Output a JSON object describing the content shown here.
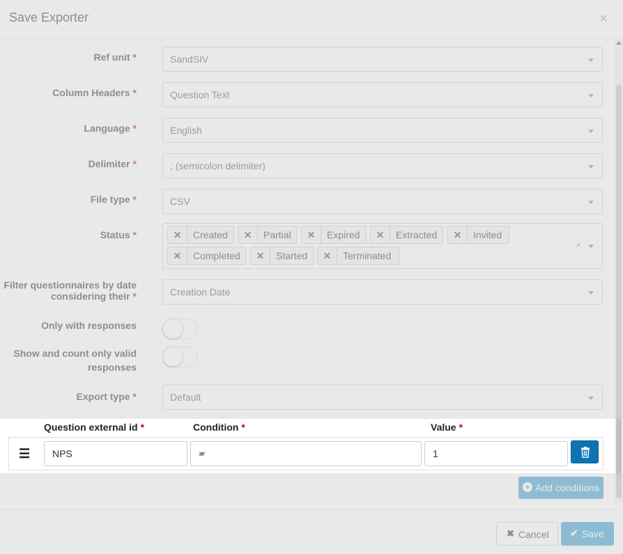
{
  "modal": {
    "title": "Save Exporter",
    "close_glyph": "×"
  },
  "form": {
    "ref_unit": {
      "label": "Ref unit",
      "value": "SandSIV"
    },
    "column_headers": {
      "label": "Column Headers",
      "value": "Question Text"
    },
    "language": {
      "label": "Language",
      "value": "English"
    },
    "delimiter": {
      "label": "Delimiter",
      "value": "; (semicolon delimiter)"
    },
    "file_type": {
      "label": "File type",
      "value": "CSV"
    },
    "status": {
      "label": "Status",
      "tags": [
        "Created",
        "Partial",
        "Expired",
        "Extracted",
        "Invited",
        "Completed",
        "Started",
        "Terminated"
      ],
      "clear_glyph": "×"
    },
    "filter_date": {
      "label_line1": "Filter questionnaires by date",
      "label_line2": "considering their",
      "value": "Creation Date"
    },
    "only_responses": {
      "label": "Only with responses"
    },
    "valid_responses": {
      "label_line1": "Show and count only valid",
      "label_line2": "responses"
    },
    "export_type": {
      "label": "Export type",
      "value": "Default"
    },
    "required_mark": "*"
  },
  "conditions": {
    "headers": {
      "question_id": "Question external id",
      "condition": "Condition",
      "value": "Value"
    },
    "row": {
      "drag_glyph": "☰",
      "question_id": "NPS",
      "condition": "=",
      "value": "1"
    },
    "add_label": "Add conditions",
    "add_icon": "plus-circle-icon"
  },
  "footer": {
    "cancel_label": "Cancel",
    "cancel_icon": "✖",
    "save_label": "Save",
    "save_icon": "✔"
  },
  "colors": {
    "primary": "#0d74b3",
    "accent": "#339ccd",
    "required": "#cc0000"
  }
}
